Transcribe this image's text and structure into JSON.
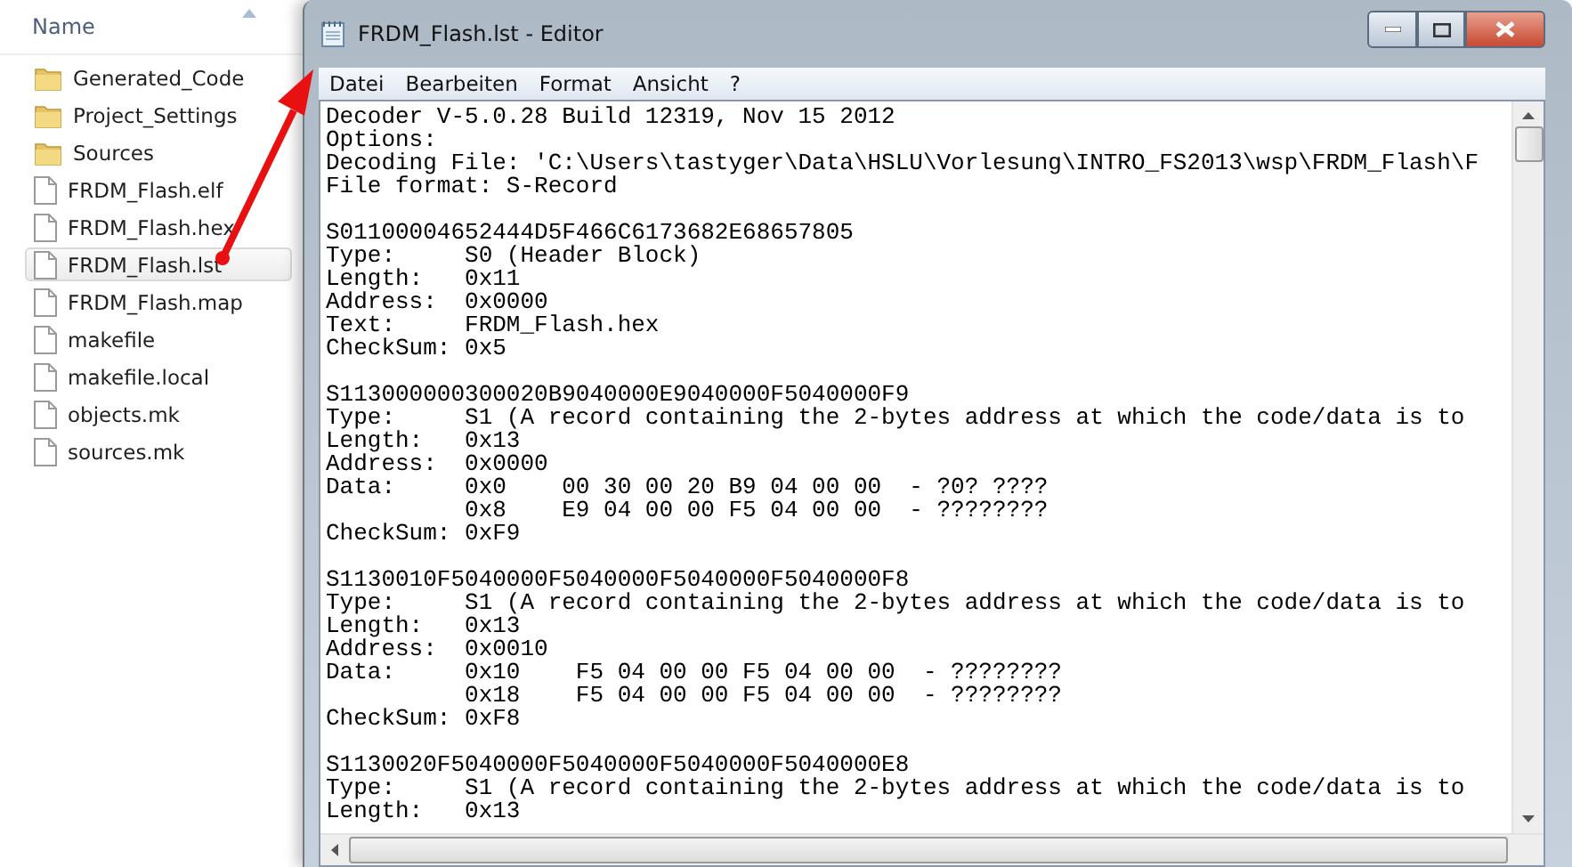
{
  "explorer": {
    "column_header": "Name",
    "items": [
      {
        "name": "Generated_Code",
        "kind": "folder",
        "selected": false
      },
      {
        "name": "Project_Settings",
        "kind": "folder",
        "selected": false
      },
      {
        "name": "Sources",
        "kind": "folder",
        "selected": false
      },
      {
        "name": "FRDM_Flash.elf",
        "kind": "file",
        "selected": false
      },
      {
        "name": "FRDM_Flash.hex",
        "kind": "file",
        "selected": false
      },
      {
        "name": "FRDM_Flash.lst",
        "kind": "file",
        "selected": true
      },
      {
        "name": "FRDM_Flash.map",
        "kind": "file",
        "selected": false
      },
      {
        "name": "makefile",
        "kind": "file",
        "selected": false
      },
      {
        "name": "makefile.local",
        "kind": "file",
        "selected": false
      },
      {
        "name": "objects.mk",
        "kind": "file",
        "selected": false
      },
      {
        "name": "sources.mk",
        "kind": "file",
        "selected": false
      }
    ]
  },
  "editor": {
    "title": "FRDM_Flash.lst - Editor",
    "menu": [
      "Datei",
      "Bearbeiten",
      "Format",
      "Ansicht",
      "?"
    ],
    "blocks": [
      [
        "Decoder V-5.0.28 Build 12319, Nov 15 2012",
        "Options:",
        "Decoding File: 'C:\\Users\\tastyger\\Data\\HSLU\\Vorlesung\\INTRO_FS2013\\wsp\\FRDM_Flash\\F",
        "File format: S-Record"
      ],
      [
        "S01100004652444D5F466C6173682E68657805",
        "Type:     S0 (Header Block)",
        "Length:   0x11",
        "Address:  0x0000",
        "Text:     FRDM_Flash.hex",
        "CheckSum: 0x5"
      ],
      [
        "S113000000300020B9040000E9040000F5040000F9",
        "Type:     S1 (A record containing the 2-bytes address at which the code/data is to",
        "Length:   0x13",
        "Address:  0x0000",
        "Data:     0x0    00 30 00 20 B9 04 00 00  - ?0? ????",
        "          0x8    E9 04 00 00 F5 04 00 00  - ????????",
        "CheckSum: 0xF9"
      ],
      [
        "S1130010F5040000F5040000F5040000F5040000F8",
        "Type:     S1 (A record containing the 2-bytes address at which the code/data is to",
        "Length:   0x13",
        "Address:  0x0010",
        "Data:     0x10    F5 04 00 00 F5 04 00 00  - ????????",
        "          0x18    F5 04 00 00 F5 04 00 00  - ????????",
        "CheckSum: 0xF8"
      ],
      [
        "S1130020F5040000F5040000F5040000F5040000E8",
        "Type:     S1 (A record containing the 2-bytes address at which the code/data is to",
        "Length:   0x13"
      ]
    ]
  }
}
